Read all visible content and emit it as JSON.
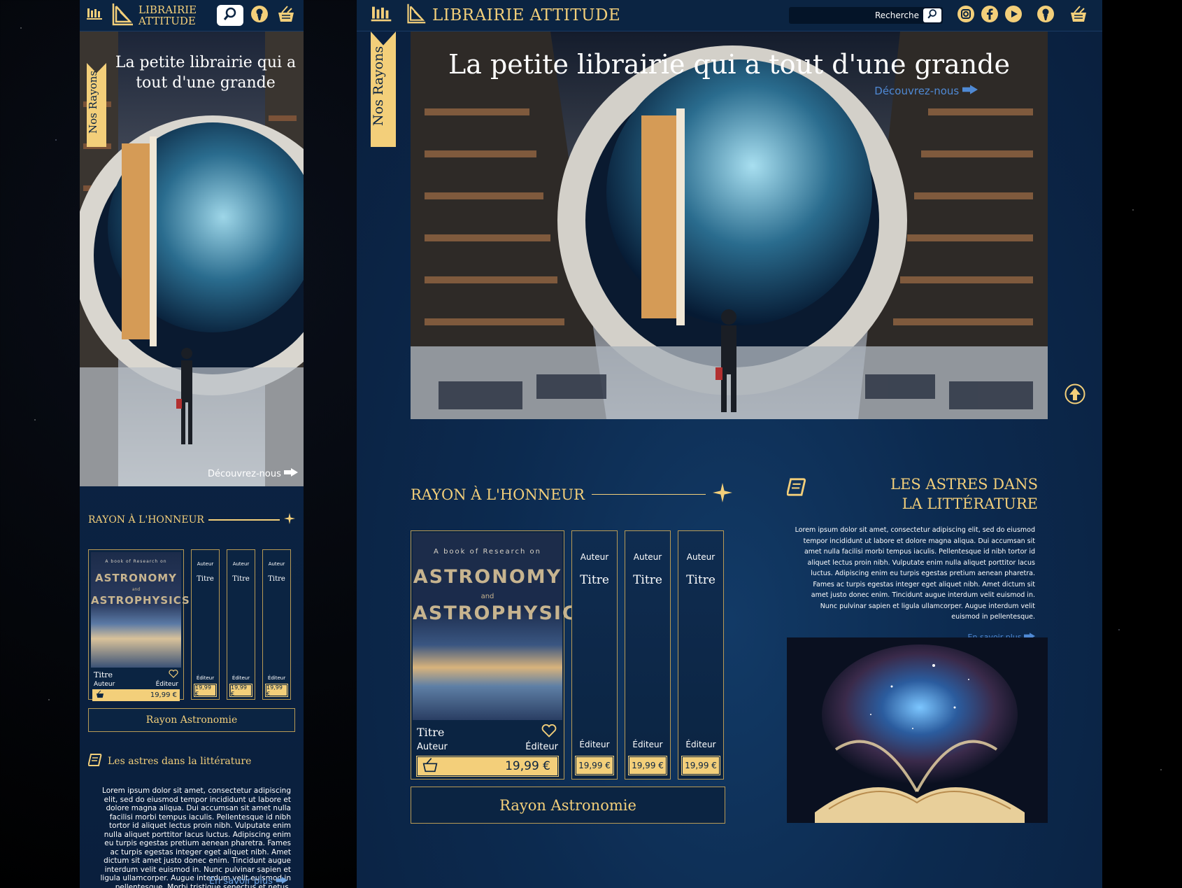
{
  "brand": {
    "name_mobile_line1": "LIBRAIRIE",
    "name_mobile_line2": "ATTITUDE",
    "name_desktop": "LIBRAIRIE ATTITUDE",
    "gold": "#f3cf7a",
    "navy": "#0b2442"
  },
  "bookmark_label": "Nos Rayons",
  "hero": {
    "title": "La petite librairie qui a tout d'une grande",
    "title_mobile": "La petite librairie qui a tout d'une grande",
    "discover": "Découvrez-nous"
  },
  "search": {
    "label": "Recherche"
  },
  "featured": {
    "title": "RAYON À L'HONNEUR",
    "cover": {
      "line1": "A book of Research on",
      "line2": "ASTRONOMY",
      "line3": "and",
      "line4": "ASTROPHYSICS",
      "title": "Titre",
      "author": "Auteur",
      "editor": "Éditeur",
      "price": "19,99 €"
    },
    "spines": [
      {
        "author": "Auteur",
        "title": "Titre",
        "editor": "Éditeur",
        "price": "19,99 €"
      },
      {
        "author": "Auteur",
        "title": "Titre",
        "editor": "Éditeur",
        "price": "19,99 €"
      },
      {
        "author": "Auteur",
        "title": "Titre",
        "editor": "Éditeur",
        "price": "19,99 €"
      }
    ],
    "button": "Rayon Astronomie"
  },
  "astres": {
    "title_mobile": "Les astres dans la littérature",
    "title_line1": "LES ASTRES DANS",
    "title_line2": "LA LITTÉRATURE",
    "text_desktop": "Lorem ipsum dolor sit amet, consectetur adipiscing elit, sed do eiusmod tempor incididunt ut labore et dolore magna aliqua. Dui accumsan sit amet nulla facilisi morbi tempus iaculis. Pellentesque id nibh tortor id aliquet lectus proin nibh. Vulputate enim nulla aliquet porttitor lacus luctus. Adipiscing enim eu turpis egestas pretium aenean pharetra. Fames ac turpis egestas integer eget aliquet nibh. Amet dictum sit amet justo donec enim. Tincidunt augue interdum velit euismod in. Nunc pulvinar sapien et ligula ullamcorper. Augue interdum velit euismod in pellentesque.",
    "text_mobile": "Lorem ipsum dolor sit amet, consectetur adipiscing elit, sed do eiusmod tempor incididunt ut labore et dolore magna aliqua. Dui accumsan sit amet nulla facilisi morbi tempus iaculis. Pellentesque id nibh tortor id aliquet lectus proin nibh. Vulputate enim nulla aliquet porttitor lacus luctus. Adipiscing enim eu turpis egestas pretium aenean pharetra. Fames ac turpis egestas integer eget aliquet nibh. Amet dictum sit amet justo donec enim. Tincidunt augue interdum velit euismod in. Nunc pulvinar sapien et ligula ullamcorper. Augue interdum velit euismod in pellentesque. Morbi tristique senectus et netus. Cum sociis natoque penatibus et. Enim diam vulputate ut pharetra sit amet aliquam. Fermentum dui faucibus in ornare ?",
    "more": "En savoir plus"
  },
  "icons": [
    "shelf-icon",
    "logo-icon",
    "search-icon",
    "account-icon",
    "basket-icon",
    "instagram-icon",
    "facebook-icon",
    "youtube-icon",
    "arrow-right-icon",
    "star-icon",
    "heart-icon",
    "scroll-icon",
    "up-arrow-icon"
  ]
}
